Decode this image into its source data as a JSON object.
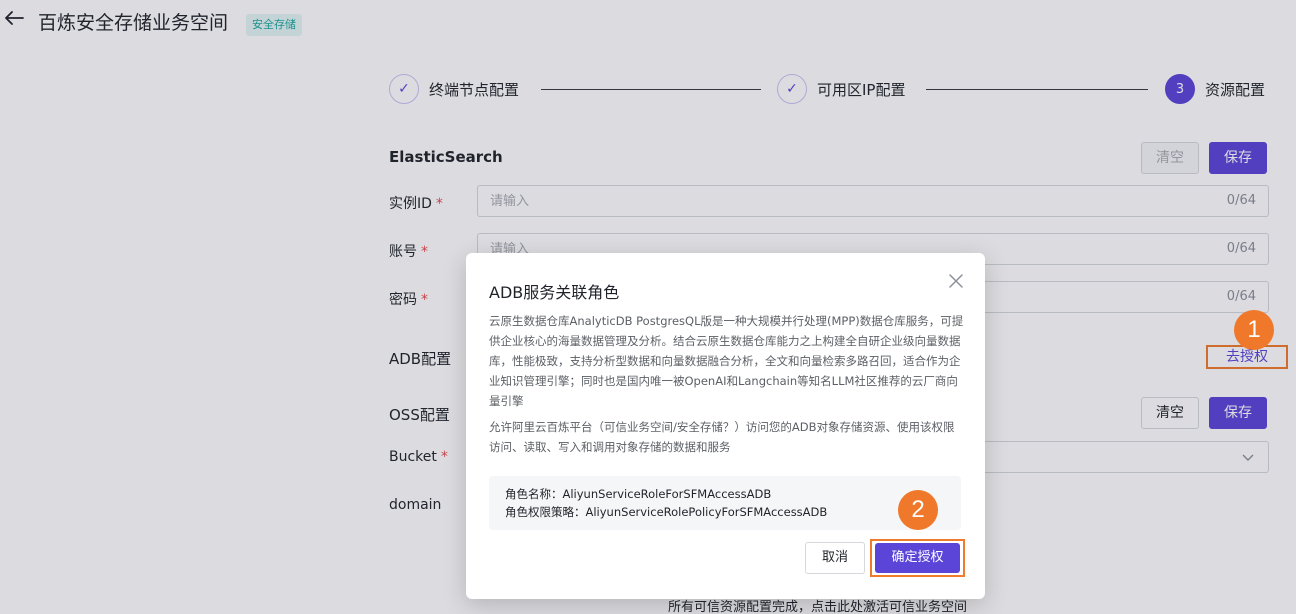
{
  "header": {
    "title": "百炼安全存储业务空间",
    "tag": "安全存储"
  },
  "steps": [
    {
      "label": "终端节点配置",
      "mark": "✓"
    },
    {
      "label": "可用区IP配置",
      "mark": "✓"
    },
    {
      "label": "资源配置",
      "mark": "3"
    }
  ],
  "elasticsearch": {
    "title": "ElasticSearch",
    "clear_label": "清空",
    "save_label": "保存",
    "fields": [
      {
        "label": "实例ID",
        "placeholder": "请输入",
        "counter": "0/64"
      },
      {
        "label": "账号",
        "placeholder": "请输入",
        "counter": "0/64"
      },
      {
        "label": "密码",
        "placeholder": "",
        "counter": "0/64"
      }
    ]
  },
  "adb": {
    "title": "ADB配置",
    "go_auth_label": "去授权"
  },
  "oss": {
    "title": "OSS配置",
    "clear_label": "清空",
    "save_label": "保存",
    "bucket_label": "Bucket",
    "domain_label": "domain"
  },
  "footer_hint": "所有可信资源配置完成，点击此处激活可信业务空间",
  "annotations": {
    "badge1": "1",
    "badge2": "2"
  },
  "modal": {
    "title": "ADB服务关联角色",
    "description": "云原生数据仓库AnalyticDB PostgresQL版是一种大规模并行处理(MPP)数据仓库服务，可提供企业核心的海量数据管理及分析。结合云原生数据仓库能力之上构建全自研企业级向量数据库，性能极致，支持分析型数据和向量数据融合分析，全文和向量检索多路召回，适合作为企业知识管理引擎；同时也是国内唯一被OpenAI和Langchain等知名LLM社区推荐的云厂商向量引擎",
    "allow_text": "允许阿里云百炼平台（可信业务空间/安全存储？）访问您的ADB对象存储资源、使用该权限访问、读取、写入和调用对象存储的数据和服务",
    "role_name": "角色名称：AliyunServiceRoleForSFMAccessADB",
    "role_policy": "角色权限策略：AliyunServiceRolePolicyForSFMAccessADB",
    "cancel_label": "取消",
    "confirm_label": "确定授权"
  },
  "colors": {
    "primary": "#5b45d9",
    "highlight": "#f07b2d",
    "tag_text": "#1aa8a0"
  }
}
